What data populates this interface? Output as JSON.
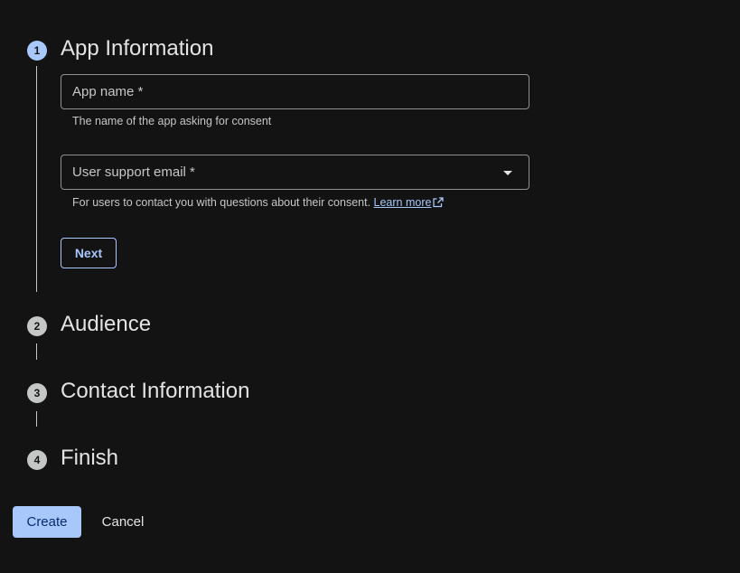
{
  "steps": [
    {
      "number": "1",
      "title": "App Information"
    },
    {
      "number": "2",
      "title": "Audience"
    },
    {
      "number": "3",
      "title": "Contact Information"
    },
    {
      "number": "4",
      "title": "Finish"
    }
  ],
  "app_info": {
    "app_name_label": "App name *",
    "app_name_hint": "The name of the app asking for consent",
    "support_email_label": "User support email *",
    "support_email_hint": "For users to contact you with questions about their consent.",
    "learn_more": "Learn more",
    "next_label": "Next"
  },
  "footer": {
    "create_label": "Create",
    "cancel_label": "Cancel"
  },
  "colors": {
    "background": "#131314",
    "accent": "#a8c7fa",
    "text": "#e3e3e3"
  }
}
